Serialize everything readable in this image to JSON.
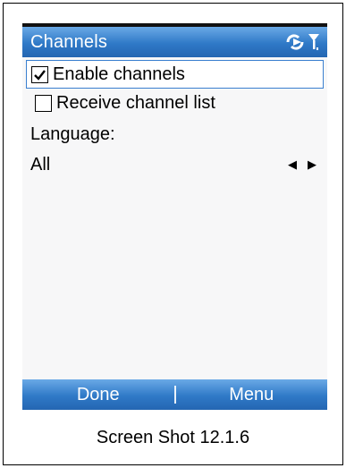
{
  "window": {
    "title": "Channels"
  },
  "status_icons": [
    "connectivity-icon",
    "signal-strength-icon"
  ],
  "options": [
    {
      "label": "Enable channels",
      "checked": true
    },
    {
      "label": "Receive channel list",
      "checked": false
    }
  ],
  "language": {
    "label": "Language:",
    "value": "All"
  },
  "softkeys": {
    "left": "Done",
    "right": "Menu"
  },
  "caption": "Screen Shot 12.1.6",
  "colors": {
    "accent": "#2f79c7",
    "background": "#f7f7f8"
  }
}
